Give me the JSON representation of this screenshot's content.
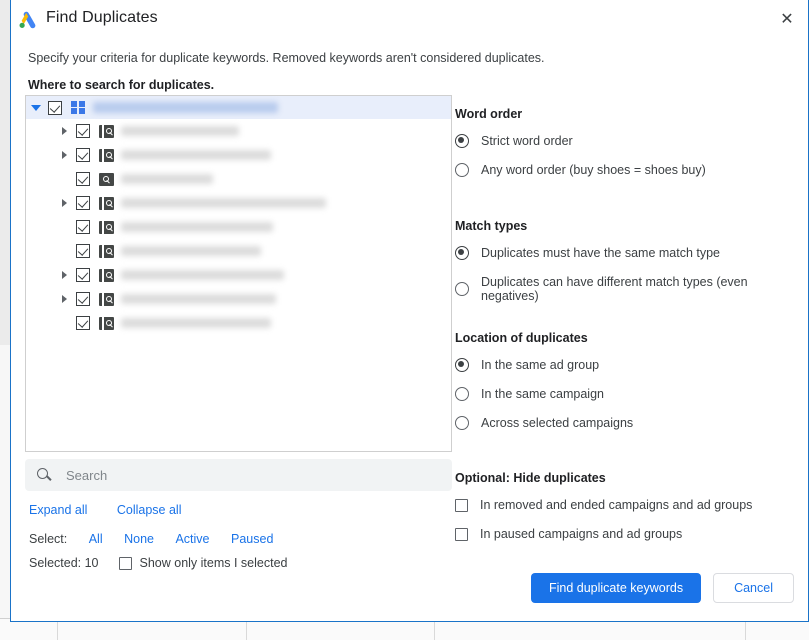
{
  "dialog": {
    "title": "Find Duplicates",
    "logo_icon": "google-ads-logo",
    "close_icon": "✕",
    "subtitle": "Specify your criteria for duplicate keywords. Removed keywords aren't considered duplicates.",
    "where_label": "Where to search for duplicates."
  },
  "tree": {
    "root": {
      "label": "",
      "icon": "grid-icon",
      "checked": true,
      "expanded": true
    },
    "rows": [
      {
        "label": "",
        "icon": "campaign-icon",
        "checked": true,
        "has_twisty": true,
        "indent": 1
      },
      {
        "label": "",
        "icon": "campaign-icon",
        "checked": true,
        "has_twisty": true,
        "indent": 1
      },
      {
        "label": "",
        "icon": "adgroup-icon",
        "checked": true,
        "has_twisty": false,
        "indent": 1
      },
      {
        "label": "",
        "icon": "campaign-icon",
        "checked": true,
        "has_twisty": true,
        "indent": 1
      },
      {
        "label": "",
        "icon": "campaign-icon",
        "checked": true,
        "has_twisty": false,
        "indent": 1
      },
      {
        "label": "",
        "icon": "campaign-icon",
        "checked": true,
        "has_twisty": false,
        "indent": 1
      },
      {
        "label": "",
        "icon": "campaign-icon",
        "checked": true,
        "has_twisty": true,
        "indent": 1
      },
      {
        "label": "",
        "icon": "campaign-icon",
        "checked": true,
        "has_twisty": true,
        "indent": 1
      },
      {
        "label": "",
        "icon": "campaign-icon",
        "checked": true,
        "has_twisty": false,
        "indent": 1
      }
    ]
  },
  "search": {
    "placeholder": "Search",
    "value": "",
    "icon": "search-icon"
  },
  "tree_controls": {
    "expand_all": "Expand all",
    "collapse_all": "Collapse all",
    "select_label": "Select:",
    "select_all": "All",
    "select_none": "None",
    "select_active": "Active",
    "select_paused": "Paused",
    "selected_count_label": "Selected: 10",
    "show_only_selected_label": "Show only items I selected",
    "show_only_selected_checked": false
  },
  "options": {
    "word_order": {
      "title": "Word order",
      "items": [
        {
          "label": "Strict word order",
          "checked": true
        },
        {
          "label": "Any word order (buy shoes = shoes buy)",
          "checked": false
        }
      ]
    },
    "match_types": {
      "title": "Match types",
      "items": [
        {
          "label": "Duplicates must have the same match type",
          "checked": true
        },
        {
          "label": "Duplicates can have different match types (even negatives)",
          "checked": false
        }
      ]
    },
    "location": {
      "title": "Location of duplicates",
      "items": [
        {
          "label": "In the same ad group",
          "checked": true
        },
        {
          "label": "In the same campaign",
          "checked": false
        },
        {
          "label": "Across selected campaigns",
          "checked": false
        }
      ]
    },
    "hide": {
      "title": "Optional: Hide duplicates",
      "items": [
        {
          "label": "In removed and ended campaigns and ad groups",
          "checked": false
        },
        {
          "label": "In paused campaigns and ad groups",
          "checked": false
        }
      ]
    }
  },
  "footer": {
    "primary_label": "Find duplicate keywords",
    "cancel_label": "Cancel"
  },
  "colors": {
    "accent": "#1a73e8",
    "dialog_border": "#1a73c8",
    "selected_row": "#e8eefb",
    "text": "#3c4043"
  }
}
